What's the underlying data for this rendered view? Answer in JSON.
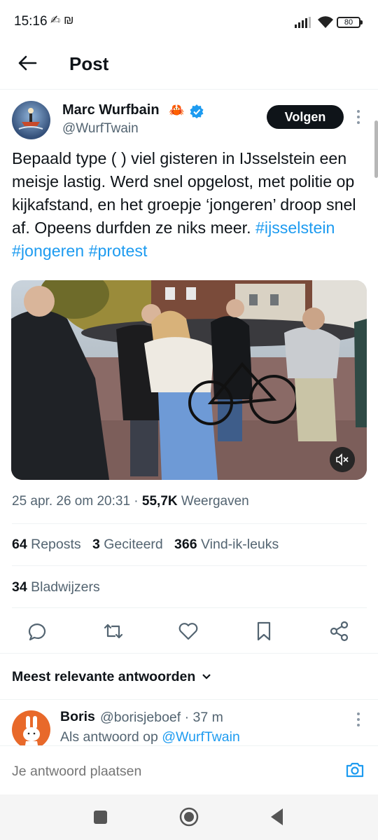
{
  "status_bar": {
    "time": "15:16",
    "left_icons": "✍︎ ₪",
    "battery": "80"
  },
  "header": {
    "title": "Post"
  },
  "post": {
    "author_name": "Marc Wurfbain",
    "author_emoji": "🦀",
    "handle": "@WurfTwain",
    "follow_label": "Volgen",
    "text_plain": "Bepaald type ( ) viel gisteren in IJsselstein een meisje lastig. Werd snel opgelost, met politie op kijkafstand, en het groepje ‘jongeren’ droop snel af. Opeens durfden ze niks meer.",
    "hashtags": [
      "#ijsselstein",
      "#jongeren",
      "#protest"
    ],
    "timestamp": "25 apr. 26 om 20:31",
    "views_count": "55,7K",
    "views_label": "Weergaven",
    "reposts_count": "64",
    "reposts_label": "Reposts",
    "quotes_count": "3",
    "quotes_label": "Geciteerd",
    "likes_count": "366",
    "likes_label": "Vind-ik-leuks",
    "bookmarks_count": "34",
    "bookmarks_label": "Bladwijzers"
  },
  "actions": [
    "reply-icon",
    "repost-icon",
    "like-icon",
    "bookmark-icon",
    "share-icon"
  ],
  "replies": {
    "sort_label": "Meest relevante antwoorden",
    "items": [
      {
        "name": "Boris",
        "handle": "@borisjeboef",
        "time": "37 m",
        "reply_to_prefix": "Als antwoord op",
        "reply_to_handle": "@WurfTwain"
      }
    ]
  },
  "composer": {
    "placeholder": "Je antwoord plaatsen"
  },
  "colors": {
    "accent": "#1d9bf0",
    "text": "#0f1419",
    "muted": "#536471"
  }
}
